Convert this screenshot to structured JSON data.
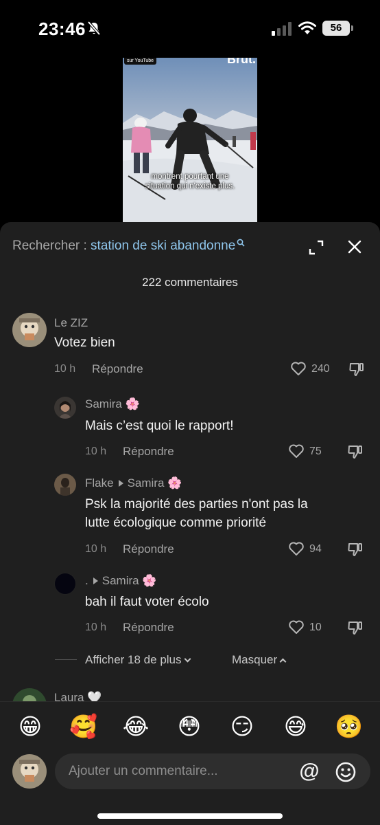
{
  "status_bar": {
    "time": "23:46",
    "battery": "56"
  },
  "video": {
    "tag": "sur YouTube",
    "brand": "Brut.",
    "subtitle_line1": "montrent pourtant une",
    "subtitle_line2": "situation qui n'existe plus."
  },
  "search": {
    "prefix": "Rechercher : ",
    "query": "station de ski abandonne"
  },
  "comments_count": "222 commentaires",
  "comments": [
    {
      "user": "Le ZIZ",
      "text": "Votez bien",
      "time": "10 h",
      "reply_label": "Répondre",
      "likes": "240"
    },
    {
      "user": "Samira",
      "emoji": "🌸",
      "text": "Mais c’est quoi le rapport!",
      "time": "10 h",
      "reply_label": "Répondre",
      "likes": "75"
    },
    {
      "user": "Flake",
      "reply_to": "Samira",
      "emoji": "🌸",
      "text_line1": "Psk la majorité des parties n'ont pas la",
      "text_line2": "lutte écologique comme priorité",
      "time": "10 h",
      "reply_label": "Répondre",
      "likes": "94"
    },
    {
      "user": ".",
      "reply_to": "Samira",
      "emoji": "🌸",
      "text": "bah il faut voter écolo",
      "time": "10 h",
      "reply_label": "Répondre",
      "likes": "10"
    },
    {
      "user": "Laura",
      "emoji": "🤍"
    }
  ],
  "more_replies": "Afficher 18 de plus",
  "hide_replies": "Masquer",
  "emoji_bar": [
    "😁",
    "🥰",
    "😂",
    "😳",
    "😏",
    "😅",
    "🥺"
  ],
  "input": {
    "placeholder": "Ajouter un commentaire...",
    "at_symbol": "@"
  },
  "colors": {
    "sheet_bg": "#1f1f1f",
    "search_query": "#8fc6ec",
    "muted": "#a6a6a6"
  }
}
